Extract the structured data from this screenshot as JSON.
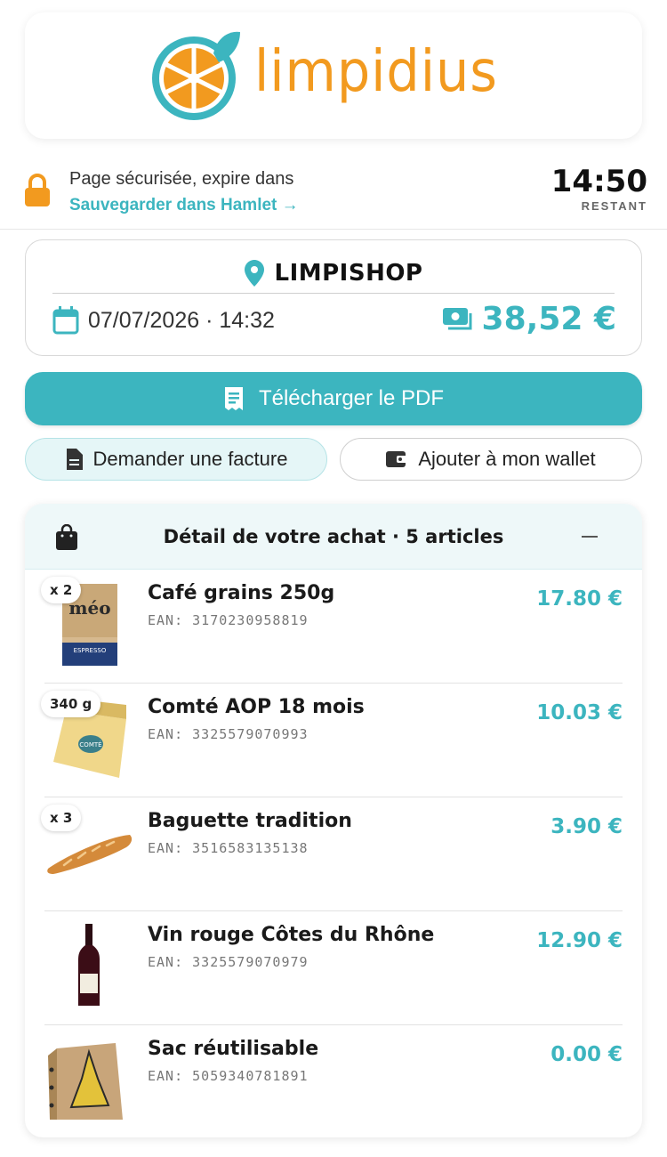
{
  "brand": {
    "name": "limpidius"
  },
  "security": {
    "message": "Page sécurisée, expire dans",
    "save_link": "Sauvegarder dans Hamlet →",
    "timer": "14:50",
    "timer_label": "RESTANT"
  },
  "store": {
    "name": "LIMPISHOP",
    "datetime": "07/07/2026 · 14:32",
    "total": "38,52 €"
  },
  "actions": {
    "download_pdf": "Télécharger le PDF",
    "request_invoice": "Demander une facture",
    "add_wallet": "Ajouter à mon wallet"
  },
  "detail": {
    "title": "Détail de votre achat · 5 articles",
    "items": [
      {
        "qty": "x 2",
        "name": "Café grains 250g",
        "ean": "EAN: 3170230958819",
        "price": "17.80 €"
      },
      {
        "qty": "340 g",
        "name": "Comté AOP 18 mois",
        "ean": "EAN: 3325579070993",
        "price": "10.03 €"
      },
      {
        "qty": "x 3",
        "name": "Baguette tradition",
        "ean": "EAN: 3516583135138",
        "price": "3.90 €"
      },
      {
        "qty": "",
        "name": "Vin rouge Côtes du Rhône",
        "ean": "EAN: 3325579070979",
        "price": "12.90 €"
      },
      {
        "qty": "",
        "name": "Sac réutilisable",
        "ean": "EAN: 5059340781891",
        "price": "0.00 €"
      }
    ]
  },
  "colors": {
    "accent": "#3cb5bf",
    "brand_orange": "#f29a1f"
  }
}
